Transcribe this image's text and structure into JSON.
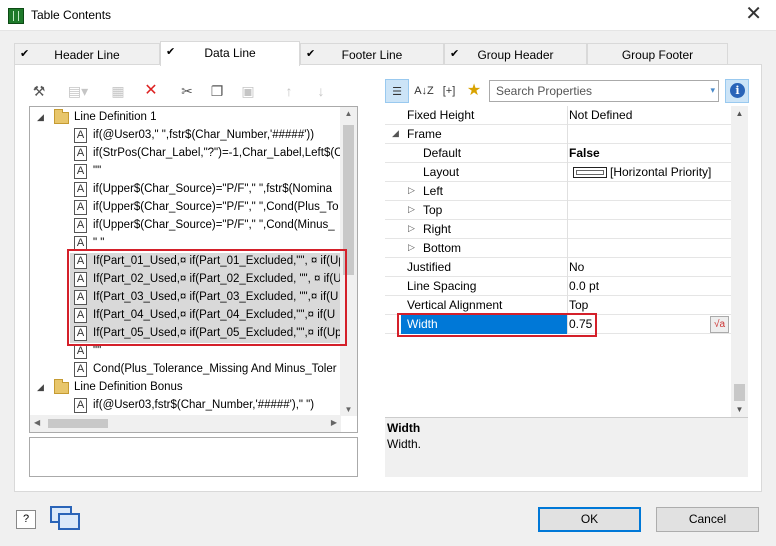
{
  "window": {
    "title": "Table Contents",
    "close_glyph": "✕"
  },
  "tabs": [
    {
      "label": "Header Line",
      "checked": true,
      "active": false
    },
    {
      "label": "Data Line",
      "checked": true,
      "active": true
    },
    {
      "label": "Footer Line",
      "checked": true,
      "active": false
    },
    {
      "label": "Group Header",
      "checked": true,
      "active": false
    },
    {
      "label": "Group Footer",
      "checked": false,
      "active": false
    }
  ],
  "left_toolbar": {
    "icons": [
      "wand-icon",
      "new-line-icon",
      "properties-icon",
      "delete-icon",
      "cut-icon",
      "copy-icon",
      "paste-icon",
      "move-up-icon",
      "move-down-icon"
    ]
  },
  "tree": {
    "definition1_label": "Line Definition  1",
    "rows": [
      "if(@User03,\" \",fstr$(Char_Number,'#####'))",
      "if(StrPos(Char_Label,\"?\")=-1,Char_Label,Left$(C",
      "\"\"",
      "if(Upper$(Char_Source)=\"P/F\",\" \",fstr$(Nomina",
      "if(Upper$(Char_Source)=\"P/F\",\" \",Cond(Plus_To",
      "if(Upper$(Char_Source)=\"P/F\",\" \",Cond(Minus_",
      "\" \"",
      "If(Part_01_Used,¤ if(Part_01_Excluded,\"\", ¤  if(Up",
      "If(Part_02_Used,¤ if(Part_02_Excluded, \"\", ¤  if(U",
      "If(Part_03_Used,¤ if(Part_03_Excluded, \"\",¤  if(U",
      "If(Part_04_Used,¤ if(Part_04_Excluded,\"\",¤   if(U",
      "If(Part_05_Used,¤ if(Part_05_Excluded,\"\",¤   if(Up",
      "\"\"",
      "Cond(Plus_Tolerance_Missing And Minus_Toler"
    ],
    "definition2_label": "Line Definition Bonus",
    "bonus_row": "if(@User03,fstr$(Char_Number,'#####'),\" \")"
  },
  "right_toolbar": {
    "search_placeholder": "Search Properties",
    "sort_label": "A↓Z",
    "expand_label": "[+]",
    "info_label": "i"
  },
  "properties": [
    {
      "name": "Fixed Height",
      "value": "Not Defined",
      "level": 0
    },
    {
      "name": "Frame",
      "value": "",
      "level": 0,
      "expander": "◢"
    },
    {
      "name": "Default",
      "value": "False",
      "level": 1,
      "bold_value": true
    },
    {
      "name": "Layout",
      "value": "[Horizontal Priority]",
      "level": 1,
      "layout_box": true
    },
    {
      "name": "Left",
      "value": "",
      "level": 1,
      "expander": "▷"
    },
    {
      "name": "Top",
      "value": "",
      "level": 1,
      "expander": "▷"
    },
    {
      "name": "Right",
      "value": "",
      "level": 1,
      "expander": "▷"
    },
    {
      "name": "Bottom",
      "value": "",
      "level": 1,
      "expander": "▷"
    },
    {
      "name": "Justified",
      "value": "No",
      "level": 0
    },
    {
      "name": "Line Spacing",
      "value": "0.0 pt",
      "level": 0
    },
    {
      "name": "Vertical Alignment",
      "value": "Top",
      "level": 0
    },
    {
      "name": "Width",
      "value": "0.75",
      "level": 0,
      "selected": true
    }
  ],
  "help": {
    "title": "Width",
    "text": "Width."
  },
  "buttons": {
    "ok": "OK",
    "cancel": "Cancel",
    "help": "?"
  },
  "colors": {
    "selection": "#0078d7",
    "highlight_border": "#d4202a",
    "accent": "#2a64b8"
  }
}
